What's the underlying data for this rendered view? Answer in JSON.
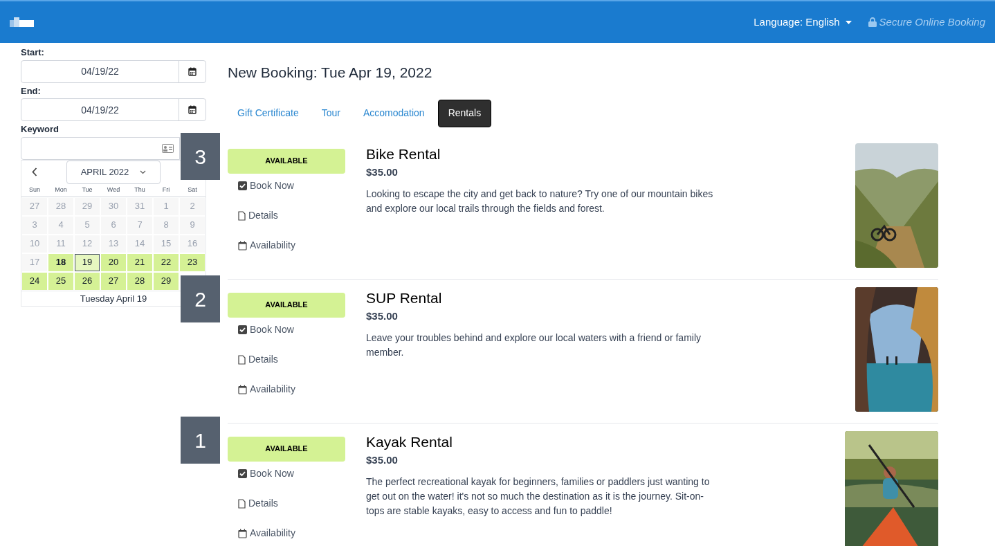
{
  "header": {
    "language": "Language: English",
    "secure": "Secure Online Booking"
  },
  "sidebar": {
    "start_label": "Start:",
    "start_value": "04/19/22",
    "end_label": "End:",
    "end_value": "04/19/22",
    "keyword_label": "Keyword",
    "calendar": {
      "month": "APRIL 2022",
      "weekdays": [
        "Sun",
        "Mon",
        "Tue",
        "Wed",
        "Thu",
        "Fri",
        "Sat"
      ],
      "days": [
        {
          "day": "27",
          "kind": "past",
          "selected": false
        },
        {
          "day": "28",
          "kind": "past",
          "selected": false
        },
        {
          "day": "29",
          "kind": "past",
          "selected": false
        },
        {
          "day": "30",
          "kind": "past",
          "selected": false
        },
        {
          "day": "31",
          "kind": "past",
          "selected": false
        },
        {
          "day": "1",
          "kind": "past",
          "selected": false
        },
        {
          "day": "2",
          "kind": "past",
          "selected": false
        },
        {
          "day": "3",
          "kind": "past",
          "selected": false
        },
        {
          "day": "4",
          "kind": "past",
          "selected": false
        },
        {
          "day": "5",
          "kind": "past",
          "selected": false
        },
        {
          "day": "6",
          "kind": "past",
          "selected": false
        },
        {
          "day": "7",
          "kind": "past",
          "selected": false
        },
        {
          "day": "8",
          "kind": "past",
          "selected": false
        },
        {
          "day": "9",
          "kind": "past",
          "selected": false
        },
        {
          "day": "10",
          "kind": "past",
          "selected": false
        },
        {
          "day": "11",
          "kind": "past",
          "selected": false
        },
        {
          "day": "12",
          "kind": "past",
          "selected": false
        },
        {
          "day": "13",
          "kind": "past",
          "selected": false
        },
        {
          "day": "14",
          "kind": "past",
          "selected": false
        },
        {
          "day": "15",
          "kind": "past",
          "selected": false
        },
        {
          "day": "16",
          "kind": "past",
          "selected": false
        },
        {
          "day": "17",
          "kind": "past",
          "selected": false
        },
        {
          "day": "18",
          "kind": "today",
          "selected": false
        },
        {
          "day": "19",
          "kind": "available",
          "selected": true
        },
        {
          "day": "20",
          "kind": "available",
          "selected": false
        },
        {
          "day": "21",
          "kind": "available",
          "selected": false
        },
        {
          "day": "22",
          "kind": "available",
          "selected": false
        },
        {
          "day": "23",
          "kind": "available",
          "selected": false
        },
        {
          "day": "24",
          "kind": "available",
          "selected": false
        },
        {
          "day": "25",
          "kind": "available",
          "selected": false
        },
        {
          "day": "26",
          "kind": "available",
          "selected": false
        },
        {
          "day": "27",
          "kind": "available",
          "selected": false
        },
        {
          "day": "28",
          "kind": "available",
          "selected": false
        },
        {
          "day": "29",
          "kind": "available",
          "selected": false
        }
      ],
      "footer": "Tuesday April 19"
    }
  },
  "main": {
    "title": "New Booking: Tue Apr 19, 2022",
    "tabs": [
      {
        "label": "Gift Certificate",
        "selected": false
      },
      {
        "label": "Tour",
        "selected": false
      },
      {
        "label": "Accomodation",
        "selected": false
      },
      {
        "label": "Rentals",
        "selected": true
      }
    ],
    "items": [
      {
        "status": "AVAILABLE",
        "actions": [
          "Book Now",
          "Details",
          "Availability"
        ],
        "name": "Bike Rental",
        "price": "$35.00",
        "description": "Looking to escape the city and get back to nature? Try one of our mountain bikes and explore our local trails through the fields and forest.",
        "picture": {
          "kind": "picture"
        }
      },
      {
        "status": "AVAILABLE",
        "actions": [
          "Book Now",
          "Details",
          "Availability"
        ],
        "name": "SUP Rental",
        "price": "$35.00",
        "description": "Leave your troubles behind and explore our local waters with a friend or family member.",
        "picture": {
          "kind": "picture"
        }
      },
      {
        "status": "AVAILABLE",
        "actions": [
          "Book Now",
          "Details",
          "Availability"
        ],
        "name": "Kayak Rental",
        "price": "$35.00",
        "description": "The perfect recreational kayak for beginners, families or paddlers just wanting to get out on the water! it's not so much the destination as it is the journey. Sit-on-tops are stable kayaks, easy to access and fun to paddle!",
        "picture": {
          "kind": "picture"
        }
      }
    ]
  },
  "badges": [
    "3",
    "2",
    "1"
  ]
}
